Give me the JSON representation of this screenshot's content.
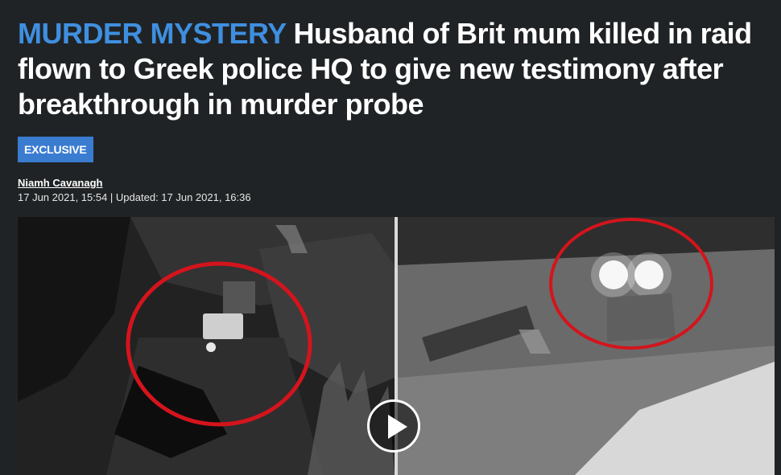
{
  "article": {
    "kicker": "MURDER MYSTERY",
    "headline": "Husband of Brit mum killed in raid flown to Greek police HQ to give new testimony after breakthrough in murder probe",
    "badge": "EXCLUSIVE",
    "author": "Niamh Cavanagh",
    "dates": "17 Jun 2021, 15:54 | Updated: 17 Jun 2021, 16:36"
  },
  "video": {
    "play_icon": "play-icon",
    "overlay_circle_color": "#d4141c"
  },
  "colors": {
    "background": "#202325",
    "kicker": "#3f8fe0",
    "badge": "#3a7cd0"
  }
}
